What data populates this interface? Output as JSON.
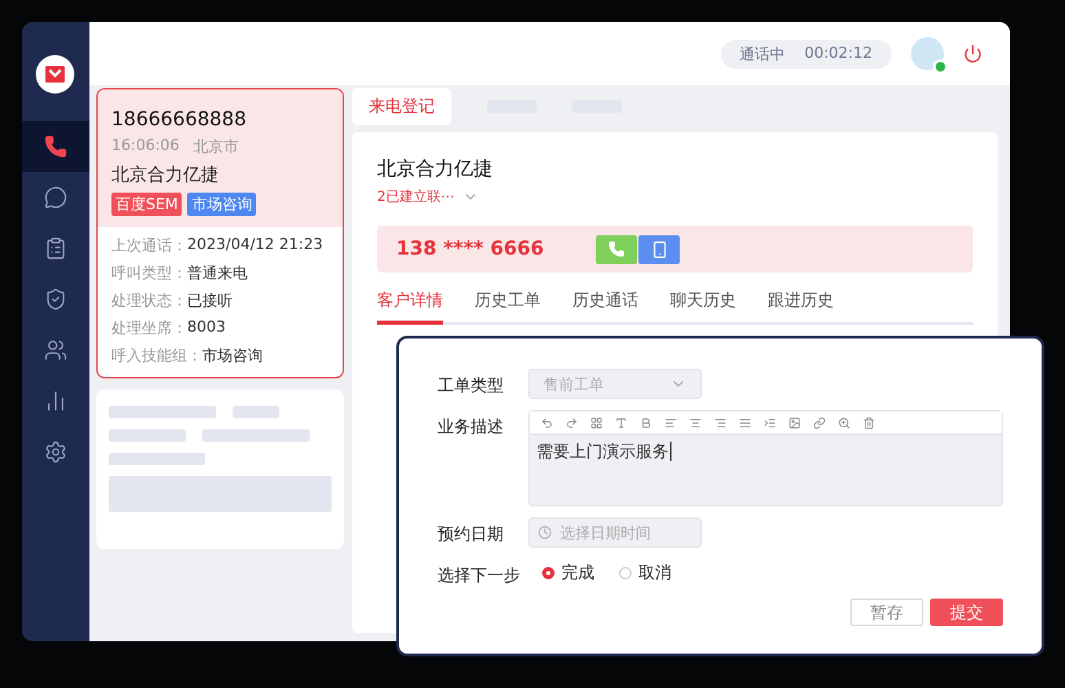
{
  "sidebar": {
    "nav": [
      {
        "selected": true
      },
      {
        "selected": false
      },
      {
        "selected": false
      },
      {
        "selected": false
      },
      {
        "selected": false
      },
      {
        "selected": false
      },
      {
        "selected": false
      }
    ]
  },
  "top_bar": {
    "call_status": "通话中",
    "call_timer": "00:02:12",
    "agent_online": true
  },
  "caller_card": {
    "phone": "18666668888",
    "time": "16:06:06",
    "city": "北京市",
    "company": "北京合力亿捷",
    "tags": [
      {
        "label": "百度SEM",
        "color": "#f0505a"
      },
      {
        "label": "市场咨询",
        "color": "#4f87f0"
      }
    ],
    "fields": [
      {
        "label": "上次通话：",
        "value": "2023/04/12 21:23"
      },
      {
        "label": "呼叫类型：",
        "value": "普通来电"
      },
      {
        "label": "处理状态：",
        "value": "已接听"
      },
      {
        "label": "处理坐席：",
        "value": "8003"
      },
      {
        "label": "呼入技能组：",
        "value": "市场咨询"
      }
    ]
  },
  "page_tabs": [
    {
      "label": "来电登记",
      "selected": true
    }
  ],
  "customer": {
    "name": "北京合力亿捷",
    "contacts": "2已建立联⋯",
    "masked_phone": "138 **** 6666",
    "tabs": [
      {
        "label": "客户详情",
        "selected": true
      },
      {
        "label": "历史工单",
        "selected": false
      },
      {
        "label": "历史通话",
        "selected": false
      },
      {
        "label": "聊天历史",
        "selected": false
      },
      {
        "label": "跟进历史",
        "selected": false
      }
    ]
  },
  "ticket_dialog": {
    "type_label": "工单类型",
    "type_value": "售前工单",
    "type_disabled": true,
    "desc_label": "业务描述",
    "desc_value": "需要上门演示服务",
    "date_label": "预约日期",
    "date_placeholder": "选择日期时间",
    "next_label": "选择下一步",
    "next_options": [
      {
        "label": "完成",
        "selected": true
      },
      {
        "label": "取消",
        "selected": false
      }
    ],
    "buttons": [
      {
        "label": "暂存",
        "kind": "secondary"
      },
      {
        "label": "提交",
        "kind": "primary"
      }
    ]
  }
}
